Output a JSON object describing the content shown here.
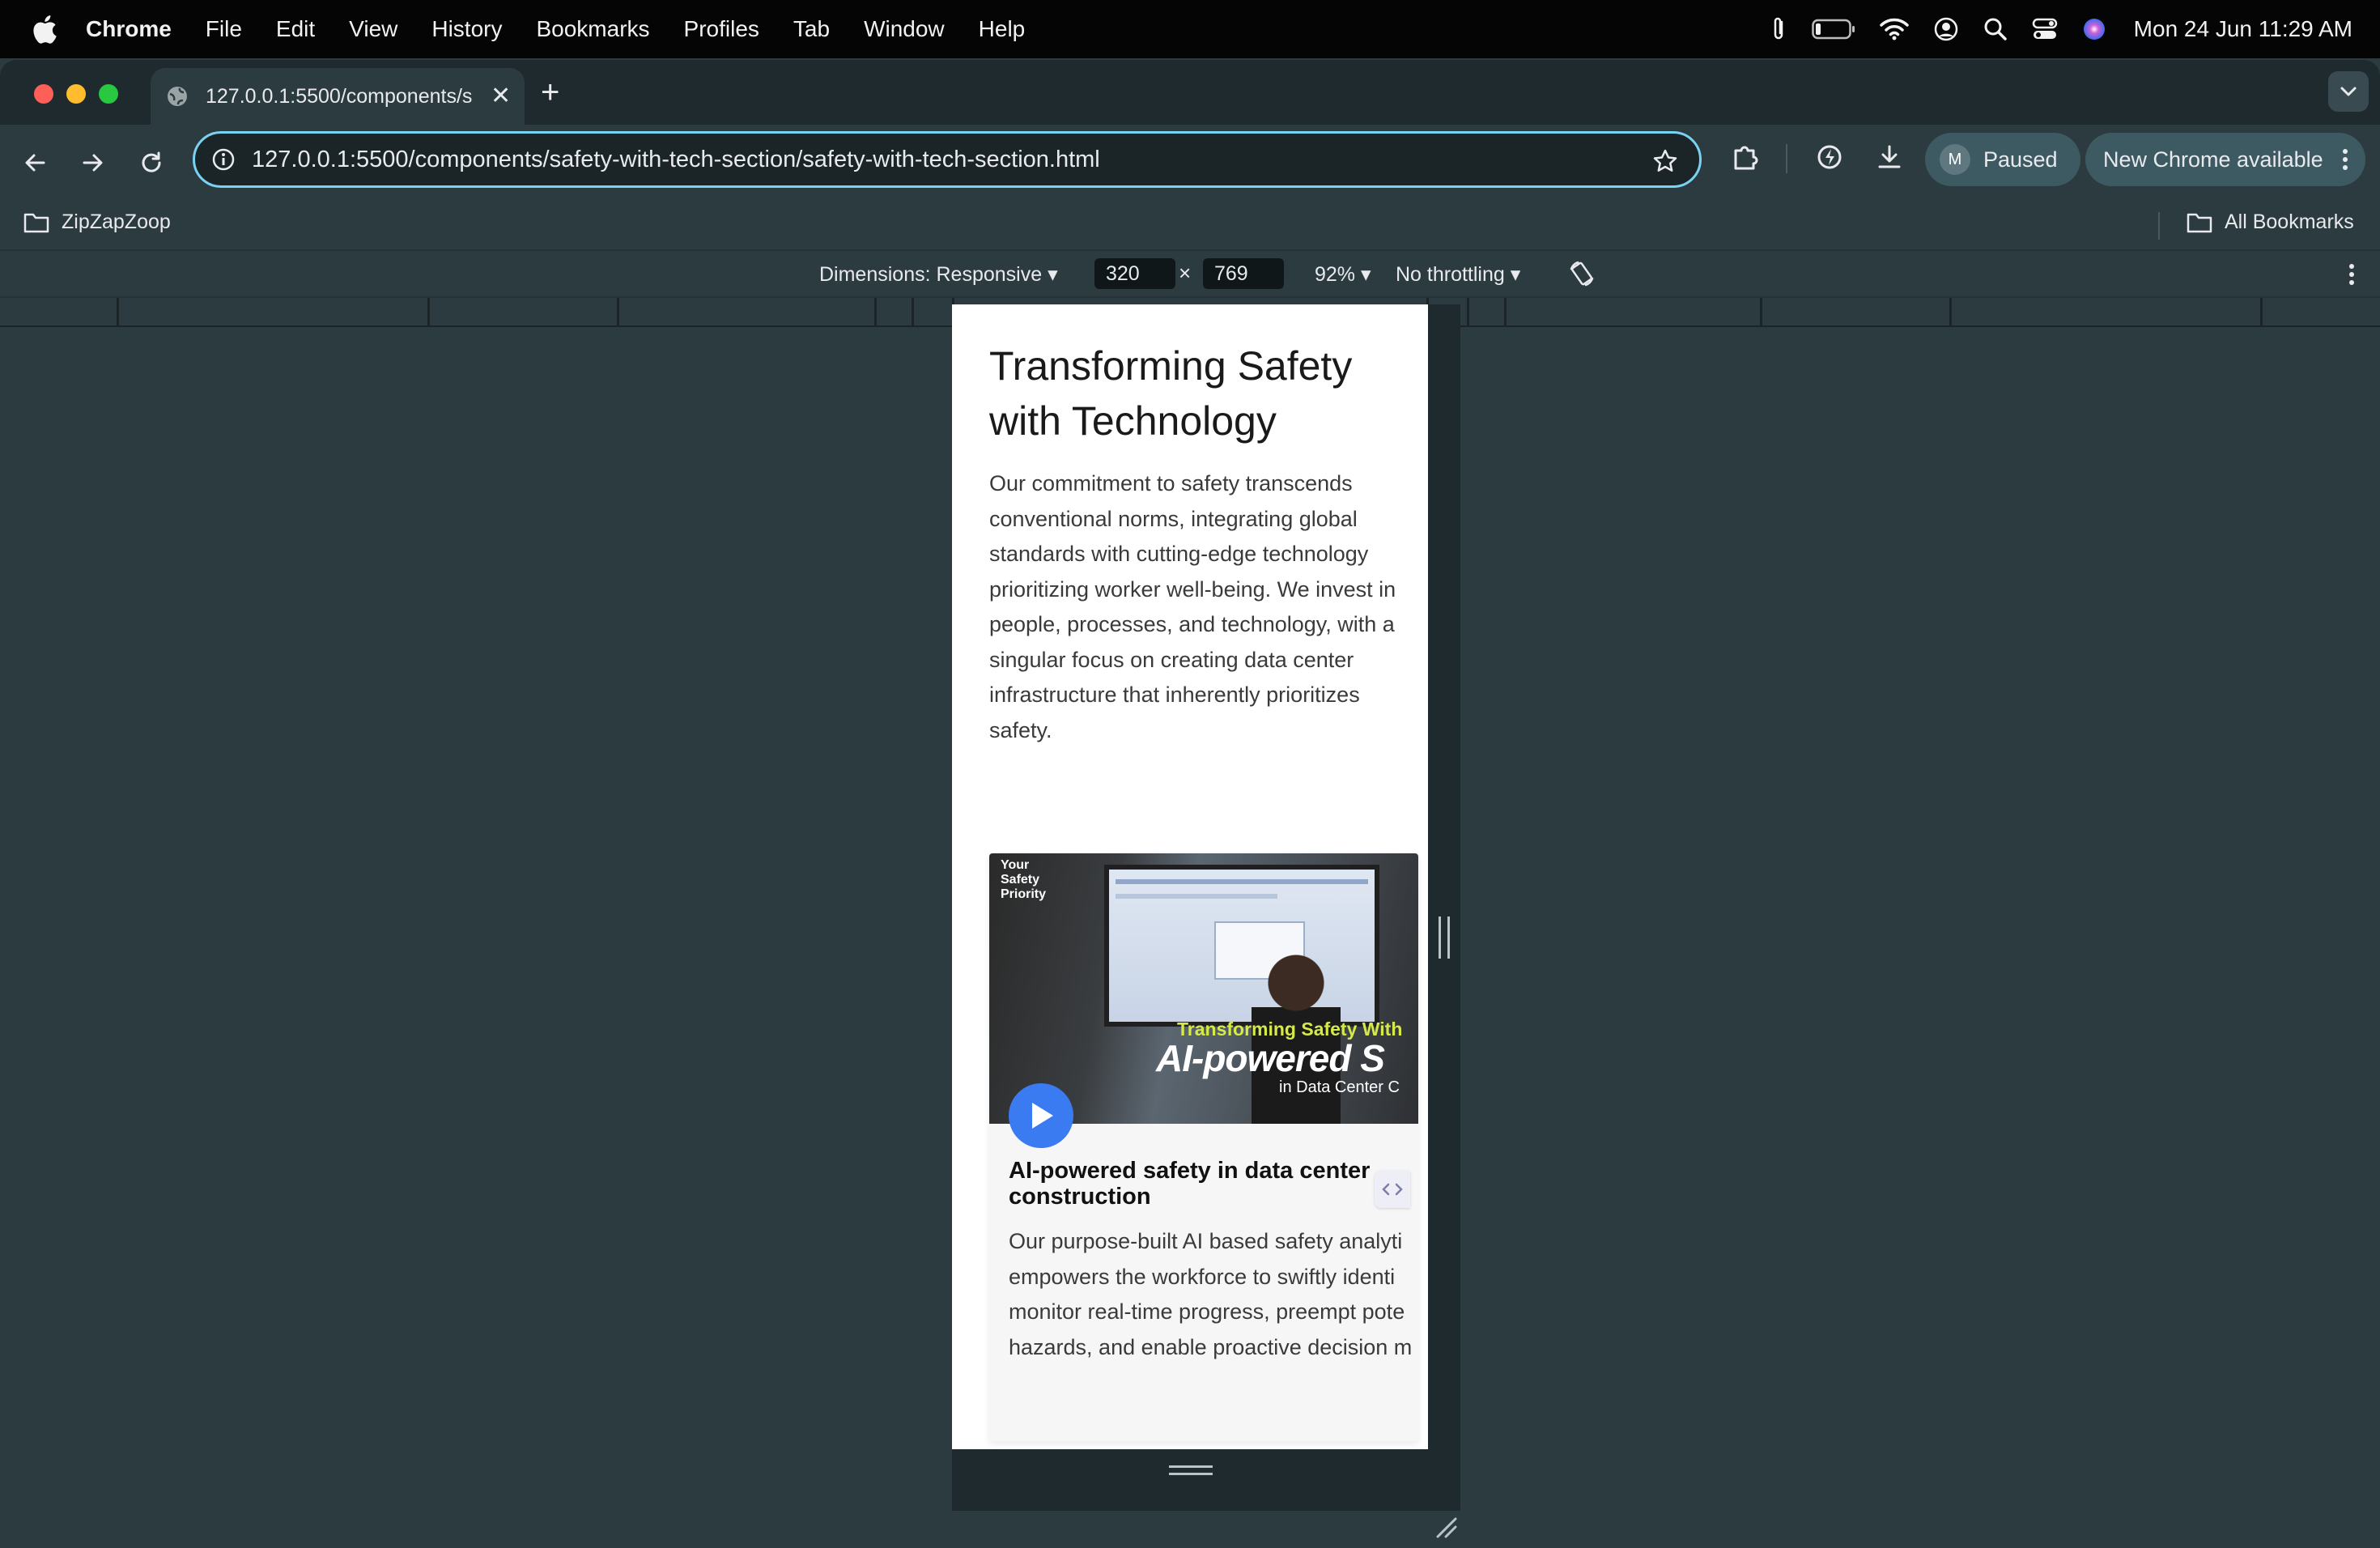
{
  "menubar": {
    "items": [
      "Chrome",
      "File",
      "Edit",
      "View",
      "History",
      "Bookmarks",
      "Profiles",
      "Tab",
      "Window",
      "Help"
    ],
    "clock": "Mon 24 Jun  11:29 AM"
  },
  "tab": {
    "title": "127.0.0.1:5500/components/s",
    "close": "✕",
    "new_tab": "+"
  },
  "omnibox": {
    "url": "127.0.0.1:5500/components/safety-with-tech-section/safety-with-tech-section.html"
  },
  "profile": {
    "initial": "M",
    "status": "Paused"
  },
  "update": {
    "label": "New Chrome available"
  },
  "bookmarks": {
    "left": "ZipZapZoop",
    "right": "All Bookmarks"
  },
  "device_toolbar": {
    "dimensions": "Dimensions: Responsive ▾",
    "width": "320",
    "times": "×",
    "height": "769",
    "zoom": "92% ▾",
    "throttling": "No throttling ▾"
  },
  "page": {
    "title": "Transforming Safety with Technology",
    "description": "Our commitment to safety transcends conventional norms, integrating global standards with cutting-edge technology prioritizing worker well-being. We invest in people, processes, and technology, with a singular focus on creating data center infrastructure that inherently prioritizes safety.",
    "card": {
      "thumbnail": {
        "badge": "Your Safety Priority",
        "subtitle": "Transforming Safety With",
        "headline": "AI-powered S",
        "small": "in Data Center C"
      },
      "title": "AI-powered safety in data center construction",
      "description_lines": [
        "Our purpose-built AI based safety analyti",
        "empowers the workforce to swiftly identi",
        "monitor real-time progress, preempt pote",
        "hazards, and enable proactive decision m"
      ]
    }
  },
  "colors": {
    "page_bg": "#2c3b40",
    "omnibox_border": "#7ad2f2",
    "play_button": "#3a7bf2",
    "overlay_accent": "#d6e94a"
  }
}
